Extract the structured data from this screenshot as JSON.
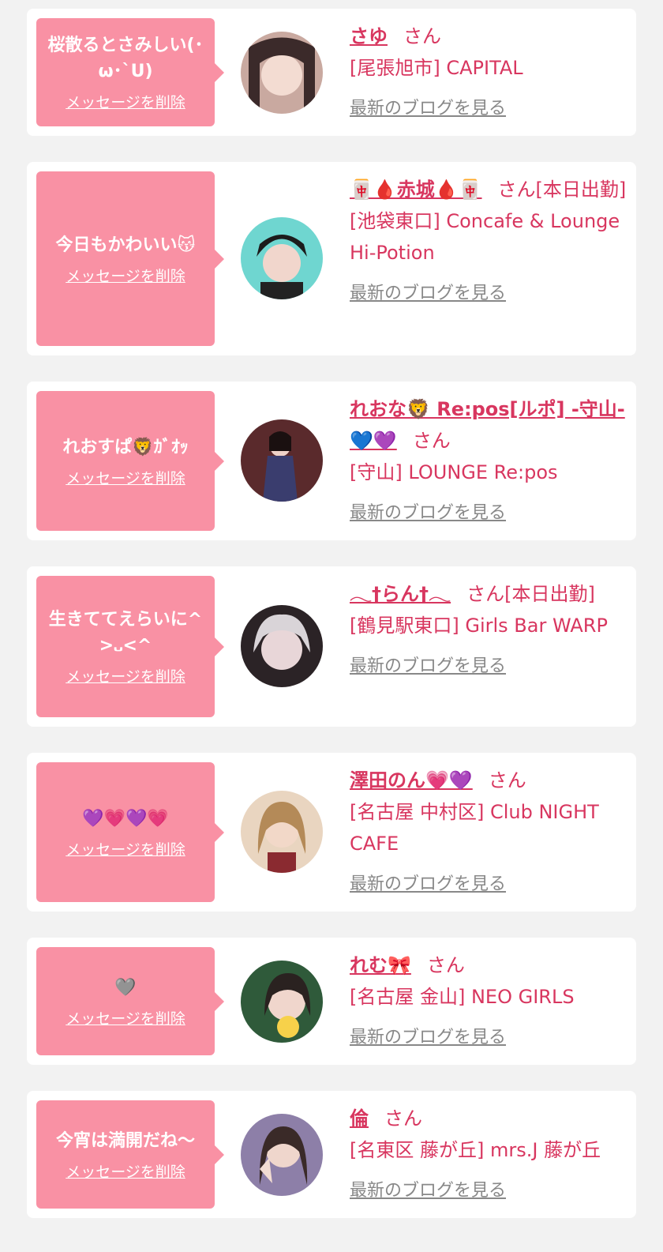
{
  "delete_label": "メッセージを削除",
  "blog_label": "最新のブログを見る",
  "san_label": "さん",
  "cards": [
    {
      "message": "桜散るとさみしい(･ω･`U)",
      "name": "さゆ",
      "suffix": "",
      "shop": "[尾張旭市] CAPITAL"
    },
    {
      "message": "今日もかわいい😽",
      "name": "🀄🩸赤城🩸🀄",
      "suffix": "[本日出勤]",
      "shop": "[池袋東口] Concafe & Lounge Hi-Potion"
    },
    {
      "message": "れおすぱ🦁ｶﾞｵｯ",
      "name": "れおな🦁 Re:pos[ルポ] -守山-💙💜",
      "suffix": "",
      "shop": "[守山] LOUNGE Re:pos"
    },
    {
      "message": "生きててえらいに^>᎑<^",
      "name": "𓂃†らん†𓂃",
      "suffix": "[本日出勤]",
      "shop": "[鶴見駅東口] Girls Bar WARP"
    },
    {
      "message": "💜💗💜💗",
      "name": "澤田のん💗💜",
      "suffix": "",
      "shop": "[名古屋 中村区] Club NIGHT CAFE"
    },
    {
      "message": "🩶",
      "name": "れむ🎀",
      "suffix": "",
      "shop": "[名古屋 金山] NEO GIRLS"
    },
    {
      "message": "今宵は満開だね〜",
      "name": "倫",
      "suffix": "",
      "shop": "[名東区 藤が丘] mrs.J 藤が丘"
    }
  ],
  "colors": {
    "bubble": "#f991a4",
    "accent": "#d8365f",
    "link_gray": "#888888",
    "background": "#f2f2f2"
  },
  "icons": [
    "avatar-photo"
  ]
}
